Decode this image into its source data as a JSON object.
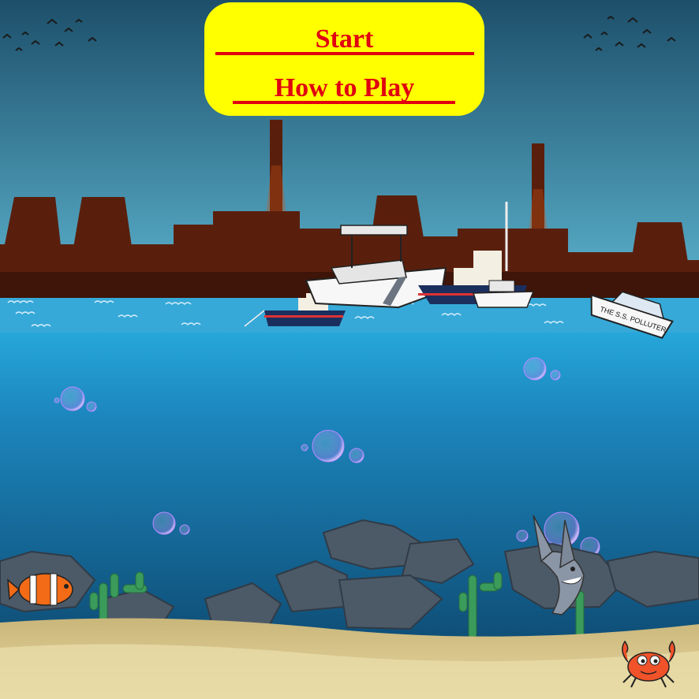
{
  "menu": {
    "start_label": "Start",
    "how_to_play_label": "How to Play",
    "panel_color": "#ffff00",
    "text_color": "#e0000f"
  },
  "scene": {
    "polluter_boat_name": "THE S.S. POLLUTER",
    "sky_color_top": "#1d4f6a",
    "sky_color_horizon": "#4fa6c4",
    "water_color": "#1f8fc4",
    "factory_color": "#5a1f0c"
  }
}
